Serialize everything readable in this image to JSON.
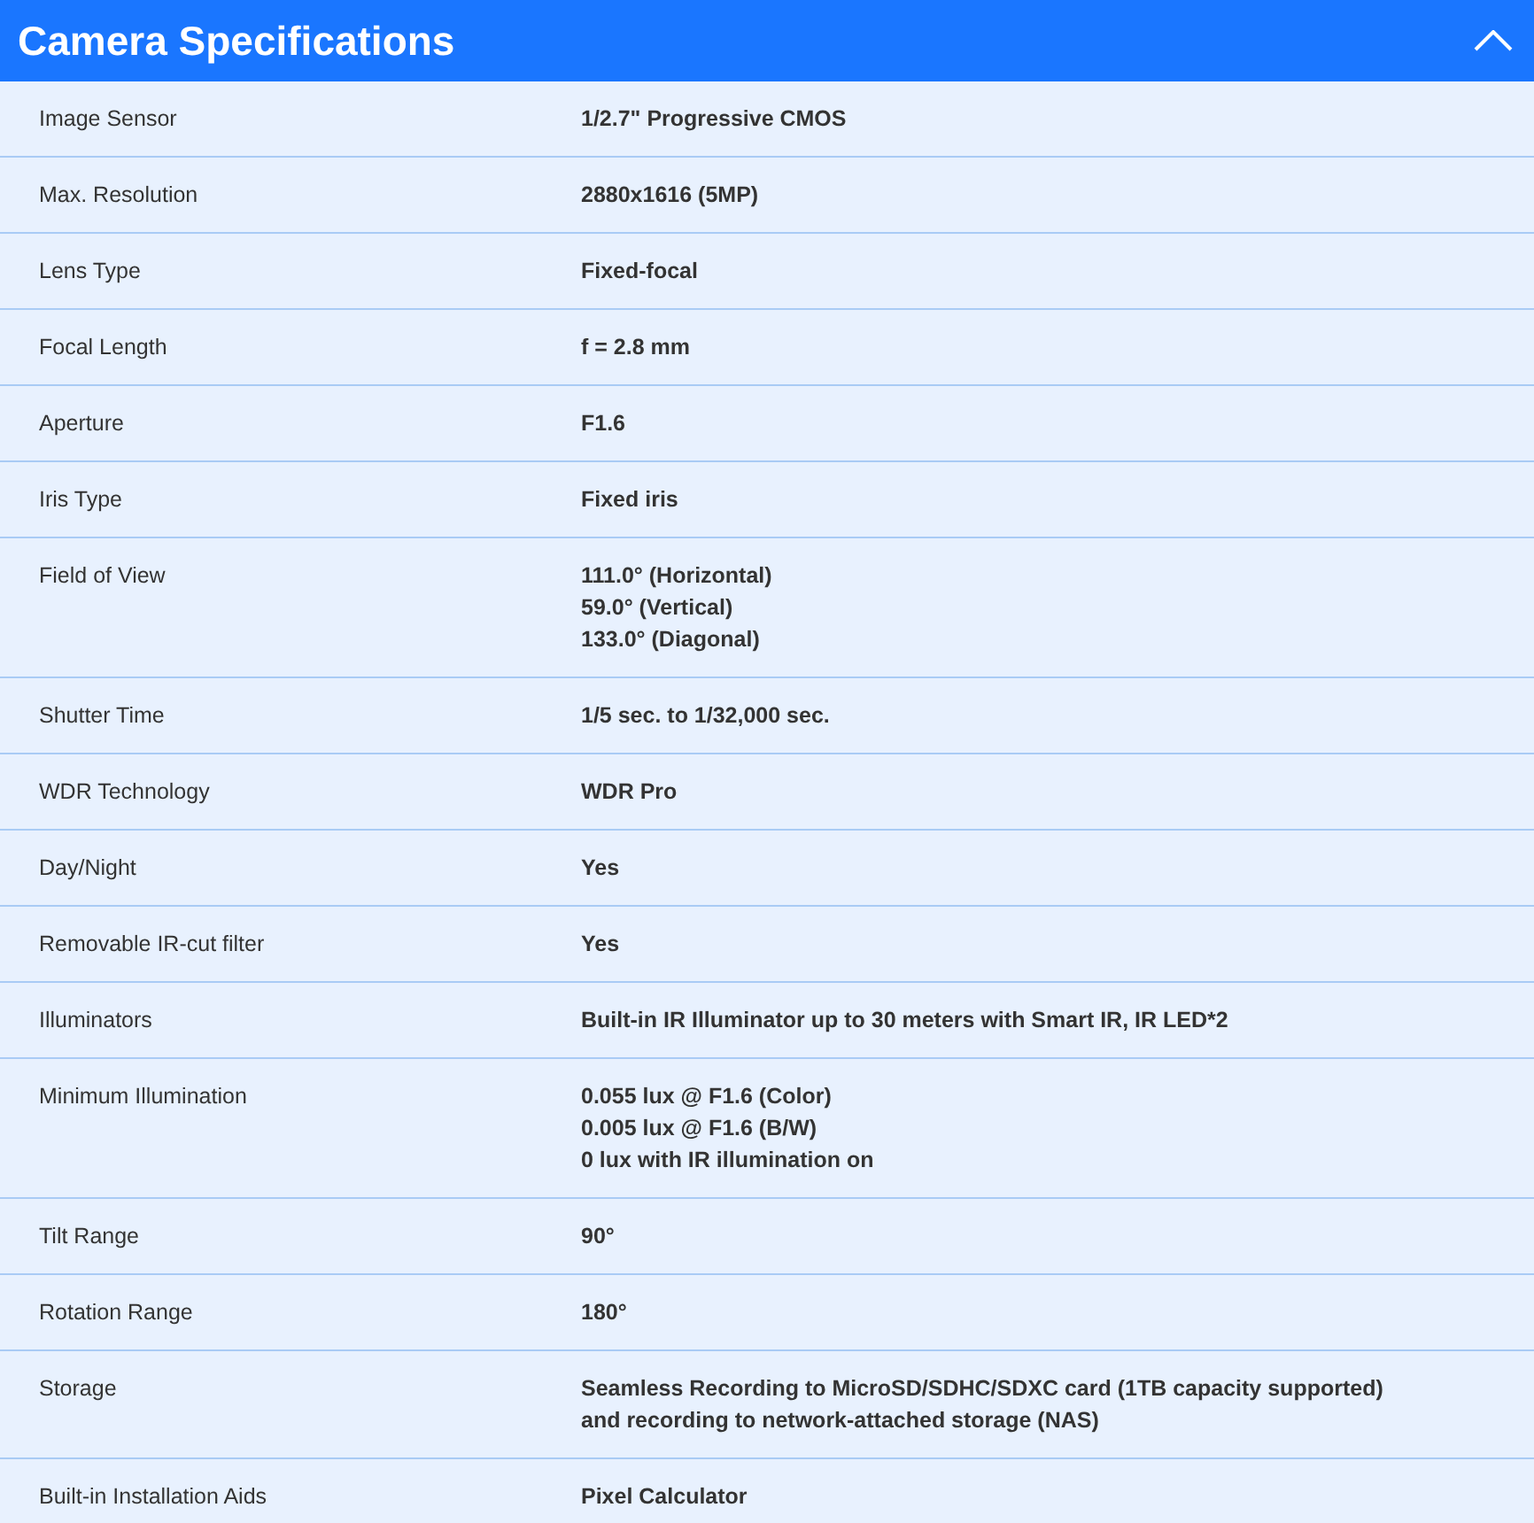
{
  "panel": {
    "title": "Camera Specifications",
    "expanded": true,
    "rows": [
      {
        "label": "Image Sensor",
        "value": [
          "1/2.7\" Progressive CMOS"
        ]
      },
      {
        "label": "Max. Resolution",
        "value": [
          "2880x1616 (5MP)"
        ]
      },
      {
        "label": "Lens Type",
        "value": [
          "Fixed-focal"
        ]
      },
      {
        "label": "Focal Length",
        "value": [
          "f = 2.8 mm"
        ]
      },
      {
        "label": "Aperture",
        "value": [
          "F1.6"
        ]
      },
      {
        "label": "Iris Type",
        "value": [
          "Fixed iris"
        ]
      },
      {
        "label": "Field of View",
        "value": [
          "111.0° (Horizontal)",
          "59.0° (Vertical)",
          "133.0° (Diagonal)"
        ]
      },
      {
        "label": "Shutter Time",
        "value": [
          "1/5 sec. to 1/32,000 sec."
        ]
      },
      {
        "label": "WDR Technology",
        "value": [
          "WDR Pro"
        ]
      },
      {
        "label": "Day/Night",
        "value": [
          "Yes"
        ]
      },
      {
        "label": "Removable IR-cut filter",
        "value": [
          "Yes"
        ]
      },
      {
        "label": "Illuminators",
        "value": [
          "Built-in IR Illuminator up to 30 meters with Smart IR, IR LED*2"
        ]
      },
      {
        "label": "Minimum Illumination",
        "value": [
          "0.055 lux @ F1.6 (Color)",
          "0.005 lux @ F1.6 (B/W)",
          "0 lux with IR illumination on"
        ]
      },
      {
        "label": "Tilt Range",
        "value": [
          "90°"
        ]
      },
      {
        "label": "Rotation Range",
        "value": [
          "180°"
        ]
      },
      {
        "label": "Storage",
        "value": [
          "Seamless Recording to MicroSD/SDHC/SDXC card (1TB capacity supported) and recording to network-attached storage (NAS)"
        ]
      },
      {
        "label": "Built-in Installation Aids",
        "value": [
          "Pixel Calculator"
        ]
      }
    ]
  }
}
